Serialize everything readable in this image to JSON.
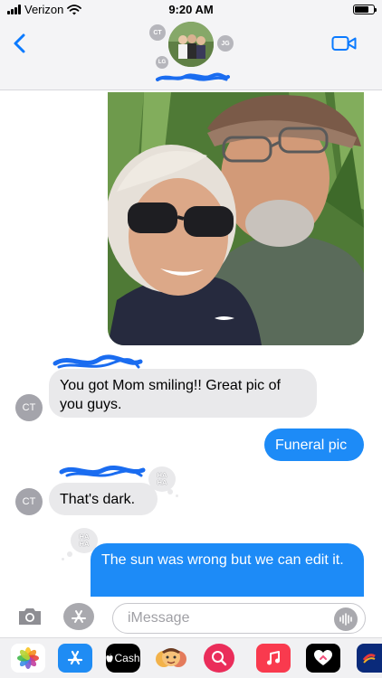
{
  "status_bar": {
    "carrier": "Verizon",
    "time": "9:20 AM",
    "battery_level": 0.75
  },
  "header": {
    "avatar_initials": [
      "CT",
      "JG",
      "LG"
    ]
  },
  "messages": [
    {
      "direction": "incoming",
      "sender": "CT",
      "text": "You got Mom smiling!! Great pic of you guys."
    },
    {
      "direction": "outgoing",
      "text": "Funeral pic"
    },
    {
      "direction": "incoming",
      "sender": "CT",
      "text": "That's dark.",
      "reaction": "HA HA"
    },
    {
      "direction": "outgoing",
      "text": "The sun was wrong but we can edit it.",
      "reaction": "HA HA"
    }
  ],
  "input": {
    "placeholder": "iMessage",
    "value": ""
  },
  "app_drawer": {
    "apps": [
      {
        "name": "photos-app",
        "icon": "flower-icon"
      },
      {
        "name": "app-store",
        "icon": "app-store-icon"
      },
      {
        "name": "apple-cash",
        "label": "Cash",
        "icon": "apple-icon"
      },
      {
        "name": "memoji",
        "icon": "memoji-icon"
      },
      {
        "name": "image-search",
        "icon": "globe-search-icon"
      },
      {
        "name": "music",
        "icon": "music-note-icon"
      },
      {
        "name": "digital-touch",
        "icon": "heart-icon"
      },
      {
        "name": "app-partial",
        "icon": "app-icon"
      }
    ]
  },
  "colors": {
    "blue_bubble": "#1d8bf7",
    "gray_bubble": "#e9e9eb",
    "accent": "#0a7aff"
  }
}
